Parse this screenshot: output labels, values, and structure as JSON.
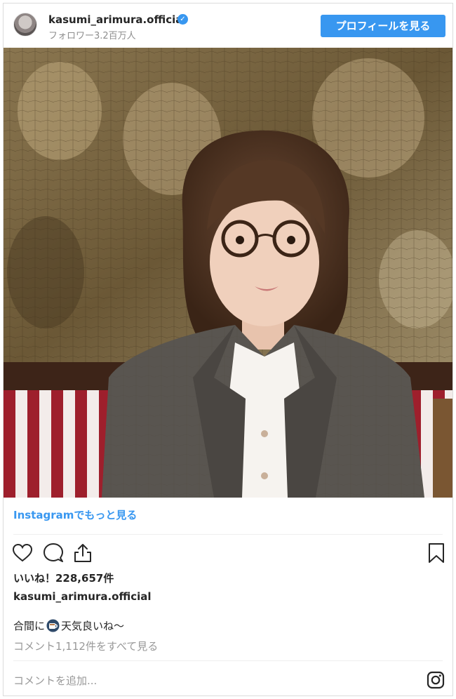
{
  "header": {
    "username": "kasumi_arimura.official",
    "followers": "フォロワー3.2百万人",
    "profile_button": "プロフィールを見る"
  },
  "post": {
    "more_link": "Instagramでもっと見る",
    "likes": "いいね！228,657件",
    "caption_user": "kasumi_arimura.official",
    "caption_before": "合間に",
    "caption_after": "天気良いね〜",
    "view_comments": "コメント1,112件をすべて見る",
    "comment_placeholder": "コメントを追加..."
  },
  "icons": {
    "like": "heart-icon",
    "comment": "comment-bubble-icon",
    "share": "share-icon",
    "save": "bookmark-icon",
    "instagram": "instagram-logo-icon",
    "verified": "verified-badge-icon",
    "caption_emoji": "coffee-cup-icon"
  },
  "colors": {
    "accent": "#3897f0",
    "text": "#262626",
    "muted": "#8e8e8e",
    "border": "#dbdbdb"
  }
}
